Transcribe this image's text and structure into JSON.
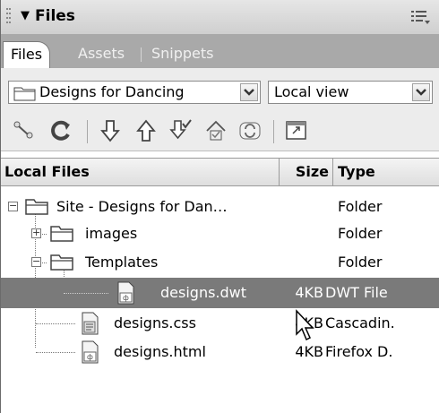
{
  "panel": {
    "title": "Files"
  },
  "tabs": [
    {
      "label": "Files",
      "active": true
    },
    {
      "label": "Assets",
      "active": false
    },
    {
      "label": "Snippets",
      "active": false
    }
  ],
  "site_select": {
    "value": "Designs for Dancing"
  },
  "view_select": {
    "value": "Local view"
  },
  "toolbar_icons": [
    "connect-icon",
    "refresh-icon",
    "get-icon",
    "put-icon",
    "check-out-icon",
    "check-in-icon",
    "synchronize-icon",
    "expand-icon"
  ],
  "columns": {
    "name": "Local Files",
    "size": "Size",
    "type": "Type"
  },
  "rows": [
    {
      "name": "Site - Designs for Dan…",
      "size": "",
      "type": "Folder",
      "kind": "folder",
      "selected": false
    },
    {
      "name": "images",
      "size": "",
      "type": "Folder",
      "kind": "folder",
      "selected": false
    },
    {
      "name": "Templates",
      "size": "",
      "type": "Folder",
      "kind": "folder",
      "selected": false
    },
    {
      "name": "designs.dwt",
      "size": "4KB",
      "type": "DWT File",
      "kind": "dwt",
      "selected": true
    },
    {
      "name": "designs.css",
      "size": "4KB",
      "type": "Cascadin.",
      "kind": "css",
      "selected": false
    },
    {
      "name": "designs.html",
      "size": "4KB",
      "type": "Firefox D.",
      "kind": "html",
      "selected": false
    }
  ],
  "colors": {
    "selected_row": "#7a7a7a",
    "tab_bar": "#a9a9a9"
  }
}
